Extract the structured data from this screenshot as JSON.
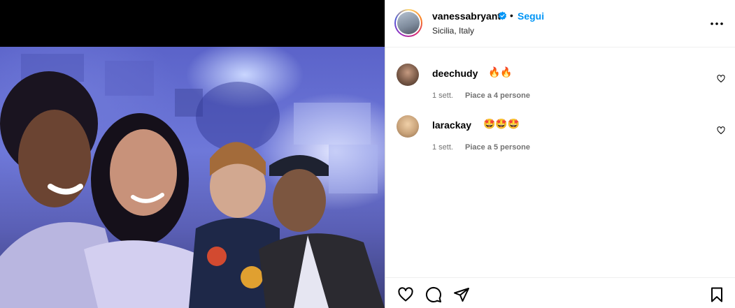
{
  "post": {
    "username": "vanessabryant",
    "verified_icon": "verified-badge-icon",
    "separator": "•",
    "follow_label": "Segui",
    "location": "Sicilia, Italy",
    "more_icon": "more-options-icon"
  },
  "comments": [
    {
      "username": "deechudy",
      "text": "🔥🔥",
      "time": "1 sett.",
      "likes": "Piace a 4 persone",
      "avatar_color": "#7a5a48"
    },
    {
      "username": "larackay",
      "text": "🤩🤩🤩",
      "time": "1 sett.",
      "likes": "Piace a 5 persone",
      "avatar_color": "#c9a37a"
    }
  ],
  "actions": [
    "like-icon",
    "comment-icon",
    "share-icon",
    "save-icon"
  ],
  "colors": {
    "accent": "#0095f6",
    "verified": "#0095f6",
    "meta": "#737373"
  }
}
